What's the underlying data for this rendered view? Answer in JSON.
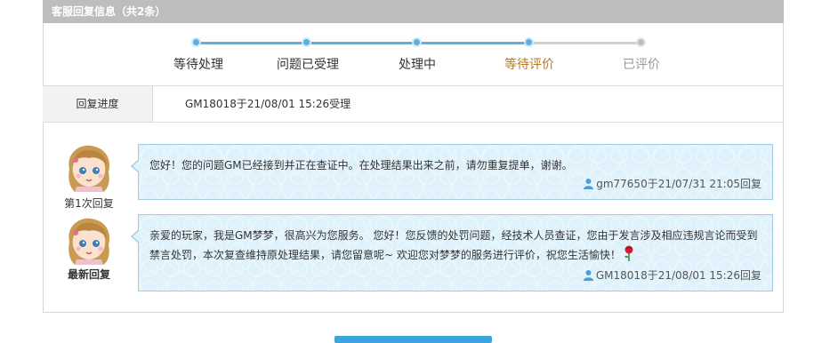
{
  "header": {
    "title": "客服回复信息（共2条）"
  },
  "progress": {
    "steps": [
      {
        "label": "等待处理",
        "state": "done"
      },
      {
        "label": "问题已受理",
        "state": "done"
      },
      {
        "label": "处理中",
        "state": "done"
      },
      {
        "label": "等待评价",
        "state": "current"
      },
      {
        "label": "已评价",
        "state": "pending"
      }
    ]
  },
  "status": {
    "label": "回复进度",
    "text": "GM18018于21/08/01 15:26受理"
  },
  "replies": [
    {
      "caption": "第1次回复",
      "message": "您好！您的问题GM已经接到并正在查证中。在处理结果出来之前，请勿重复提单，谢谢。",
      "meta": "gm77650于21/07/31 21:05回复"
    },
    {
      "caption": "最新回复",
      "message": "亲爱的玩家，我是GM梦梦，很高兴为您服务。    您好！您反馈的处罚问题，经技术人员查证，您由于发言涉及相应违规言论而受到禁言处罚，本次复查维持原处理结果，请您留意呢~ 欢迎您对梦梦的服务进行评价，祝您生活愉快！",
      "meta": "GM18018于21/08/01 15:26回复"
    }
  ],
  "colors": {
    "accent": "#5ab0e0",
    "current_step": "#b7791f",
    "header_bg": "#bdbdbd",
    "bubble_bg": "#dff2fb",
    "bubble_border": "#9fcbe4"
  },
  "icons": {
    "user": "user-icon",
    "rose": "rose-icon",
    "avatar": "avatar-girl-icon"
  }
}
